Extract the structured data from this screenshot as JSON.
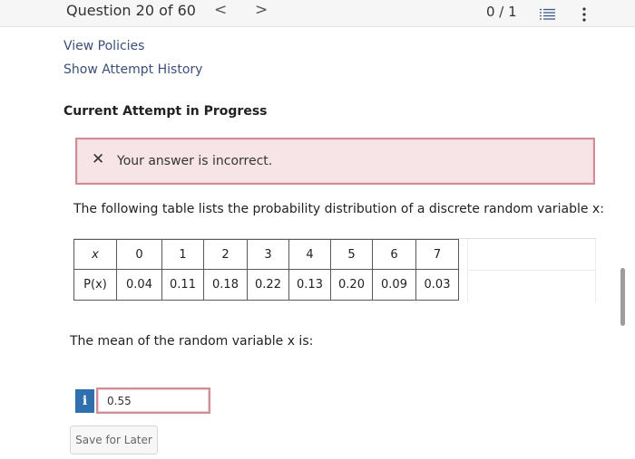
{
  "header": {
    "question_label": "Question 20 of 60",
    "prev_glyph": "<",
    "next_glyph": ">",
    "score": "0 / 1",
    "list_icon": "question-list-icon",
    "menu_icon": "kebab-menu-icon"
  },
  "links": {
    "view_policies": "View Policies",
    "show_history": "Show Attempt History"
  },
  "attempt": {
    "heading": "Current Attempt in Progress"
  },
  "feedback": {
    "icon": "x-mark-icon",
    "message": "Your answer is incorrect.",
    "colors": {
      "background": "#f6e4e6",
      "border": "#cf8e97"
    }
  },
  "question": {
    "prompt": "The following table lists the probability distribution of a discrete random variable x:",
    "table": {
      "row_headers": [
        "x",
        "P(x)"
      ],
      "x_values": [
        "0",
        "1",
        "2",
        "3",
        "4",
        "5",
        "6",
        "7"
      ],
      "p_values": [
        "0.04",
        "0.11",
        "0.18",
        "0.22",
        "0.13",
        "0.20",
        "0.09",
        "0.03"
      ]
    },
    "sub_prompt": "The mean of the random variable x is:",
    "answer_value": "0.55",
    "info_glyph": "i"
  },
  "actions": {
    "save_label": "Save for Later"
  },
  "colors": {
    "accent": "#2f6fad",
    "link": "#3a4f7a"
  }
}
